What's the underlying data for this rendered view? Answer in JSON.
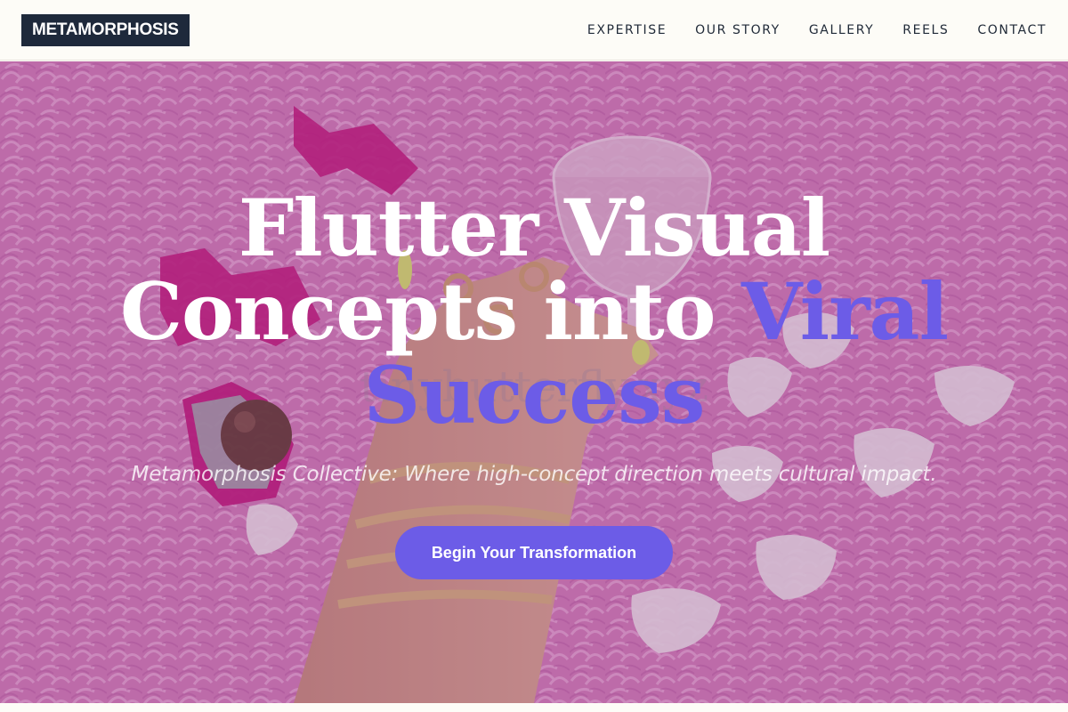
{
  "brand": {
    "logo": "METAMORPHOSIS"
  },
  "nav": {
    "items": [
      {
        "label": "EXPERTISE"
      },
      {
        "label": "OUR STORY"
      },
      {
        "label": "GALLERY"
      },
      {
        "label": "REELS"
      },
      {
        "label": "CONTACT"
      }
    ]
  },
  "hero": {
    "title_line1": "Flutter Visual",
    "title_line2": "Concepts into",
    "title_accent_1": "Viral",
    "title_accent_2": "Success",
    "subtitle": "Metamorphosis Collective: Where high-concept direction meets cultural impact.",
    "cta_label": "Begin Your Transformation",
    "watermark": "tinybutterfly.xyz"
  },
  "colors": {
    "accent": "#6c5ce7",
    "logo_bg": "#1e293b",
    "header_bg": "#fdfcf7",
    "hero_bg": "#c76db0"
  }
}
